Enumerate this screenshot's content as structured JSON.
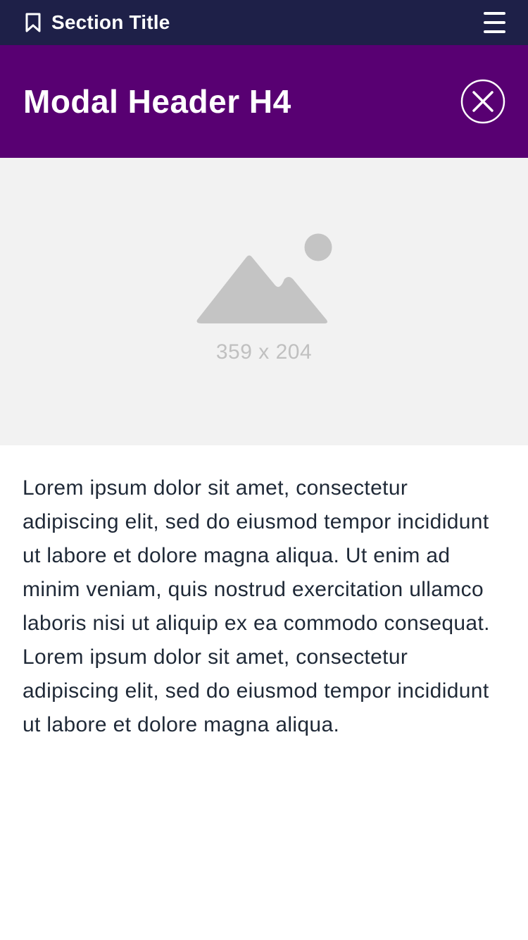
{
  "topbar": {
    "title": "Section Title",
    "bookmark_icon": "bookmark-icon",
    "menu_icon": "hamburger-menu-icon",
    "background": "#1e2048"
  },
  "modal": {
    "header": "Modal Header H4",
    "close_icon": "close-icon",
    "header_background": "#580072"
  },
  "image": {
    "icon": "image-placeholder-icon",
    "dimensions_label": "359 x 204",
    "background": "#f2f2f2"
  },
  "content": {
    "body": "Lorem ipsum dolor sit amet, consectetur adipiscing elit, sed do eiusmod tempor incididunt ut labore et dolore magna aliqua. Ut enim ad minim veniam, quis nostrud exercitation ullamco laboris nisi ut aliquip ex ea commodo consequat. Lorem ipsum dolor sit amet, consectetur adipiscing elit, sed do eiusmod tempor incididunt ut labore et dolore magna aliqua."
  }
}
